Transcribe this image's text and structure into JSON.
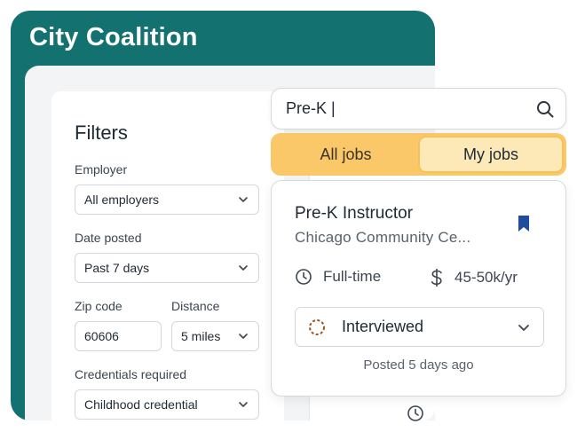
{
  "app": {
    "title": "City Coalition"
  },
  "filters": {
    "title": "Filters",
    "employer": {
      "label": "Employer",
      "value": "All employers"
    },
    "date_posted": {
      "label": "Date posted",
      "value": "Past 7 days"
    },
    "zip_code": {
      "label": "Zip code",
      "value": "60606"
    },
    "distance": {
      "label": "Distance",
      "value": "5 miles"
    },
    "credentials": {
      "label": "Credentials required",
      "value": "Childhood credential"
    }
  },
  "search": {
    "value": "Pre-K |",
    "icon": "search-icon"
  },
  "tabs": [
    {
      "label": "All jobs",
      "selected": false
    },
    {
      "label": "My jobs",
      "selected": true
    }
  ],
  "job": {
    "title": "Pre-K Instructor",
    "organization": "Chicago Community Ce...",
    "type": "Full-time",
    "pay": "45-50k/yr",
    "status": "Interviewed",
    "posted": "Posted 5 days ago",
    "bookmarked": true
  },
  "colors": {
    "brand_teal": "#137270",
    "tab_bar": "#fbc869",
    "tab_selected": "#fde8b8",
    "bookmark": "#1f4f9c",
    "status_ring": "#a0541f"
  }
}
